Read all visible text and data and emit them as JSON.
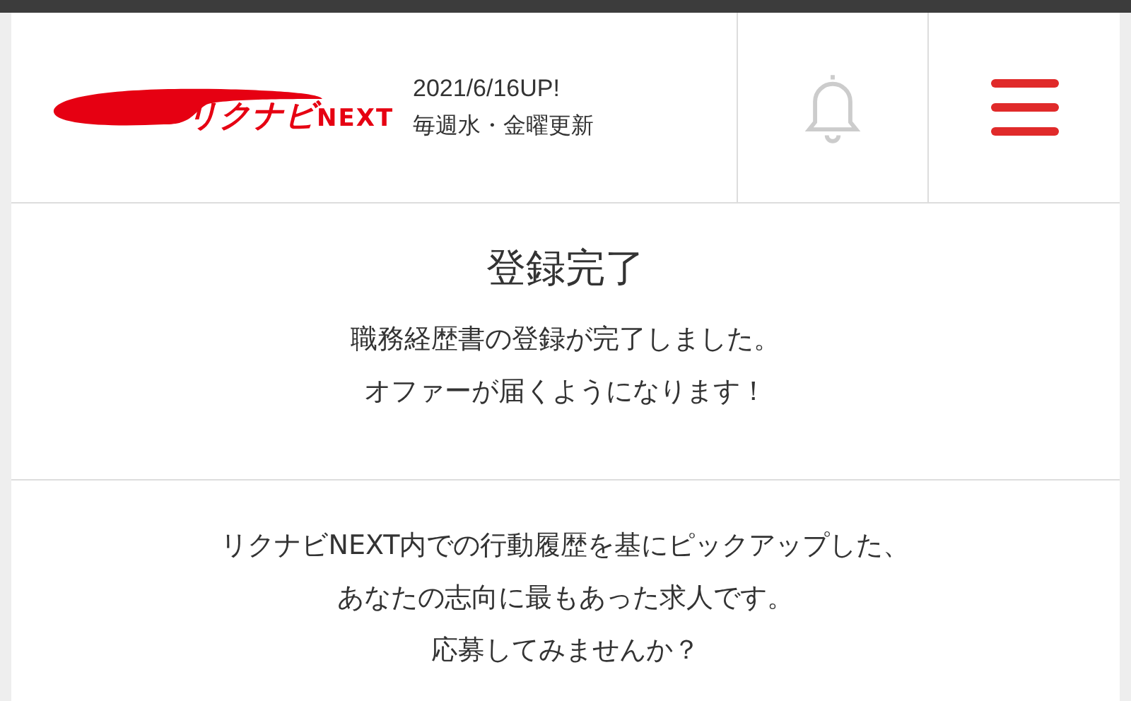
{
  "header": {
    "logo_text": "リクナビ",
    "logo_suffix": "NEXT",
    "update_date": "2021/6/16UP!",
    "update_schedule": "毎週水・金曜更新"
  },
  "completion": {
    "title": "登録完了",
    "lines": [
      "職務経歴書の登録が完了しました。",
      "オファーが届くようになります！"
    ]
  },
  "recommendation": {
    "lines": [
      "リクナビNEXT内での行動履歴を基にピックアップした、",
      "あなたの志向に最もあった求人です。",
      "応募してみませんか？"
    ]
  }
}
